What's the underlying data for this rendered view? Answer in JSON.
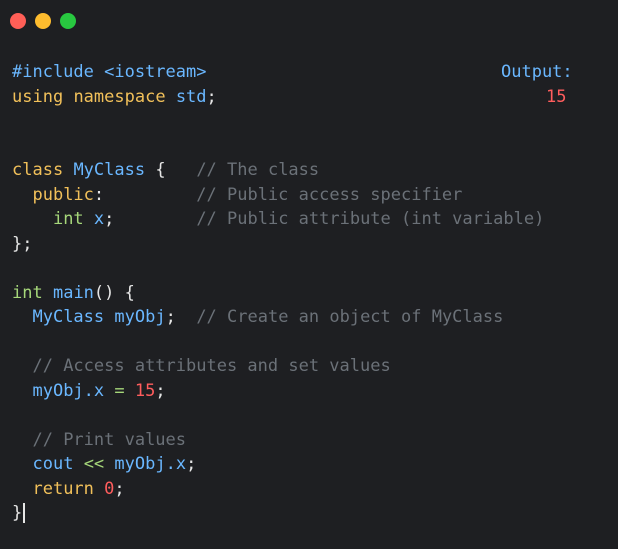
{
  "window": {
    "controls": {
      "close": "#ff5f57",
      "minimize": "#febc2e",
      "maximize": "#28c840"
    }
  },
  "output": {
    "label": "Output:",
    "value": "15"
  },
  "code": {
    "include": "#include <iostream>",
    "using_kw": "using",
    "namespace_kw": "namespace",
    "std": "std",
    "semi": ";",
    "class_kw": "class",
    "class_name": "MyClass",
    "brace_open": "{",
    "cmt_class": "// The class",
    "public_kw": "public",
    "colon": ":",
    "cmt_public": "// Public access specifier",
    "int_kw": "int",
    "x": "x",
    "cmt_attr": "// Public attribute (int variable)",
    "class_close": "};",
    "main_name": "main",
    "main_parens": "()",
    "obj_type": "MyClass",
    "obj_name": "myObj",
    "cmt_obj": "// Create an object of MyClass",
    "cmt_access": "// Access attributes and set values",
    "myobj_x": "myObj.x",
    "assign": "=",
    "fifteen": "15",
    "cmt_print": "// Print values",
    "cout": "cout",
    "shift": "<<",
    "return_kw": "return",
    "zero": "0",
    "brace_close": "}"
  }
}
